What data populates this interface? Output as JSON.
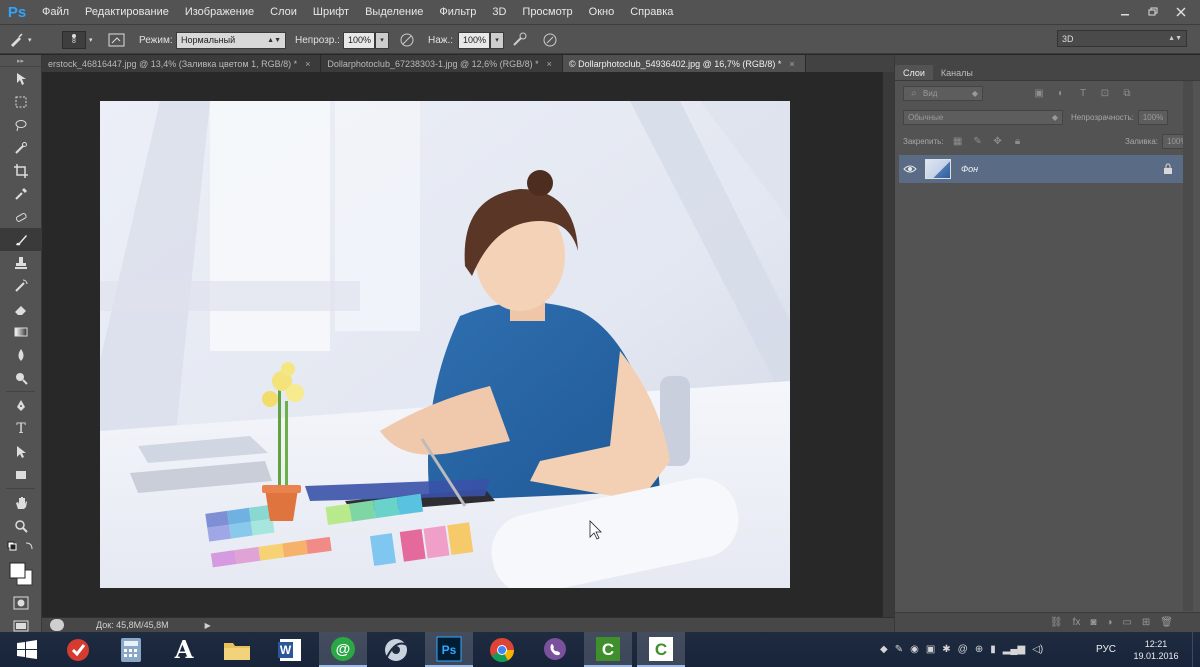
{
  "app": {
    "logo": "Ps",
    "menu": [
      "Файл",
      "Редактирование",
      "Изображение",
      "Слои",
      "Шрифт",
      "Выделение",
      "Фильтр",
      "3D",
      "Просмотр",
      "Окно",
      "Справка"
    ],
    "window_controls": [
      "minimize-icon",
      "restore-icon",
      "close-icon"
    ]
  },
  "options": {
    "brush_size": "8",
    "mode_label": "Режим:",
    "mode_value": "Нормальный",
    "opacity_label": "Непрозр.:",
    "opacity_value": "100%",
    "flow_label": "Наж.:",
    "flow_value": "100%",
    "workspace": "3D"
  },
  "tabs": [
    {
      "label": "erstock_46816447.jpg @ 13,4% (Заливка цветом 1, RGB/8) *",
      "close": "×",
      "active": false
    },
    {
      "label": "Dollarphotoclub_67238303-1.jpg @ 12,6% (RGB/8) *",
      "close": "×",
      "active": false
    },
    {
      "label": "© Dollarphotoclub_54936402.jpg @ 16,7% (RGB/8) *",
      "close": "×",
      "active": true
    }
  ],
  "status": {
    "doc_size": "Док: 45,8M/45,8M",
    "arrow": "▶"
  },
  "layers_panel": {
    "tabs": [
      "Слои",
      "Каналы"
    ],
    "filter_label": "Вид",
    "blend_mode": "Обычные",
    "opacity_label": "Непрозрачность:",
    "opacity_value": "100%",
    "lock_label": "Закрепить:",
    "fill_label": "Заливка:",
    "fill_value": "100%",
    "layers": [
      {
        "name": "Фон",
        "visible": true,
        "locked": true,
        "selected": true
      }
    ]
  },
  "taskbar": {
    "apps": [
      "windows-start-icon",
      "ccleaner-icon",
      "calculator-icon",
      "font-app-icon",
      "file-explorer-icon",
      "word-icon",
      "mail-agent-icon",
      "cd-burner-icon",
      "photoshop-icon",
      "chrome-icon",
      "viber-icon",
      "camtasia-icon",
      "camtasia-recorder-icon"
    ],
    "tray": [
      "network-icon",
      "battery-icon",
      "bluetooth-icon",
      "volume-icon",
      "signal-icon"
    ],
    "language": "РУС",
    "time": "12:21",
    "date": "19.01.2016"
  },
  "colors": {
    "ui_bg": "#535353",
    "canvas_bg": "#282828",
    "selection": "#5a6b85",
    "taskbar": "#1f2b3f"
  }
}
